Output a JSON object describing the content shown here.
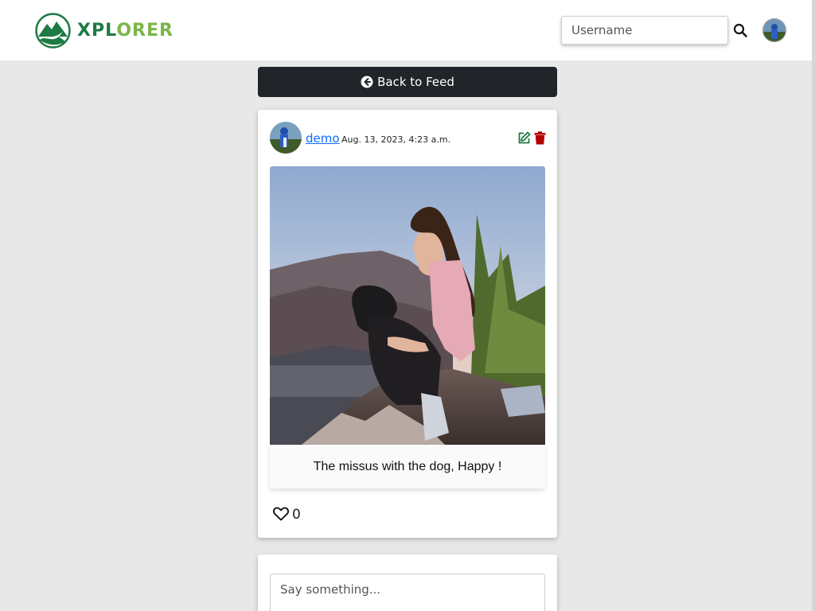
{
  "brand": {
    "name_part1": "XPL",
    "name_part2": "ORER",
    "primary_color": "#1d7a43",
    "accent_color": "#7ab648"
  },
  "navbar": {
    "search_placeholder": "Username",
    "search_icon": "search-icon",
    "avatar_icon": "user-avatar"
  },
  "back_button": {
    "label": "Back to Feed",
    "icon": "arrow-circle-left-icon"
  },
  "post": {
    "author": "demo",
    "date": "Aug. 13, 2023, 4:23 a.m.",
    "edit_icon": "edit-icon",
    "delete_icon": "trash-icon",
    "edit_color": "#1d7a43",
    "delete_color": "#b30000",
    "caption": "The missus with the dog, Happy !",
    "like_icon": "heart-outline-icon",
    "like_count": "0"
  },
  "comment": {
    "placeholder": "Say something..."
  }
}
